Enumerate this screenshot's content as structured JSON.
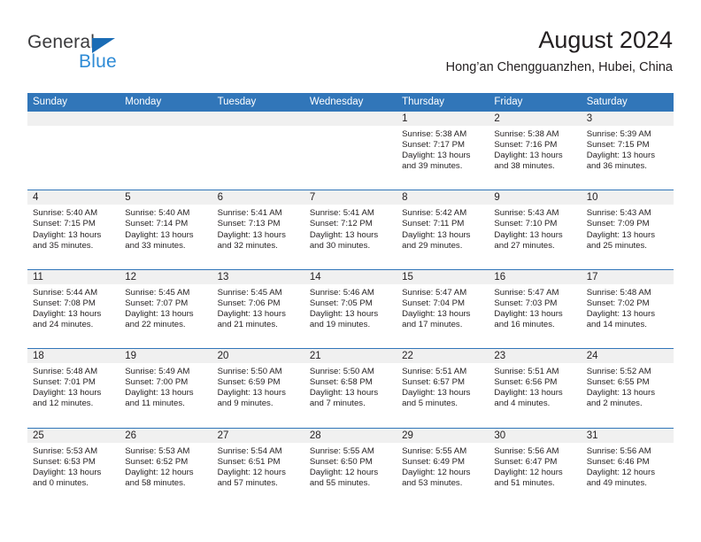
{
  "brand": {
    "name_part1": "General",
    "name_part2": "Blue",
    "triangle_color": "#1a6cb5",
    "blue_color": "#2e8bd6"
  },
  "header": {
    "title": "August 2024",
    "subtitle": "Hong’an Chengguanzhen, Hubei, China"
  },
  "colors": {
    "header_blue": "#3176b9",
    "day_band_gray": "#f0f0f0",
    "text": "#231f20"
  },
  "weekdays": [
    "Sunday",
    "Monday",
    "Tuesday",
    "Wednesday",
    "Thursday",
    "Friday",
    "Saturday"
  ],
  "weeks": [
    [
      {
        "day": "",
        "sunrise": "",
        "sunset": "",
        "daylight_line1": "",
        "daylight_line2": ""
      },
      {
        "day": "",
        "sunrise": "",
        "sunset": "",
        "daylight_line1": "",
        "daylight_line2": ""
      },
      {
        "day": "",
        "sunrise": "",
        "sunset": "",
        "daylight_line1": "",
        "daylight_line2": ""
      },
      {
        "day": "",
        "sunrise": "",
        "sunset": "",
        "daylight_line1": "",
        "daylight_line2": ""
      },
      {
        "day": "1",
        "sunrise": "Sunrise: 5:38 AM",
        "sunset": "Sunset: 7:17 PM",
        "daylight_line1": "Daylight: 13 hours",
        "daylight_line2": "and 39 minutes."
      },
      {
        "day": "2",
        "sunrise": "Sunrise: 5:38 AM",
        "sunset": "Sunset: 7:16 PM",
        "daylight_line1": "Daylight: 13 hours",
        "daylight_line2": "and 38 minutes."
      },
      {
        "day": "3",
        "sunrise": "Sunrise: 5:39 AM",
        "sunset": "Sunset: 7:15 PM",
        "daylight_line1": "Daylight: 13 hours",
        "daylight_line2": "and 36 minutes."
      }
    ],
    [
      {
        "day": "4",
        "sunrise": "Sunrise: 5:40 AM",
        "sunset": "Sunset: 7:15 PM",
        "daylight_line1": "Daylight: 13 hours",
        "daylight_line2": "and 35 minutes."
      },
      {
        "day": "5",
        "sunrise": "Sunrise: 5:40 AM",
        "sunset": "Sunset: 7:14 PM",
        "daylight_line1": "Daylight: 13 hours",
        "daylight_line2": "and 33 minutes."
      },
      {
        "day": "6",
        "sunrise": "Sunrise: 5:41 AM",
        "sunset": "Sunset: 7:13 PM",
        "daylight_line1": "Daylight: 13 hours",
        "daylight_line2": "and 32 minutes."
      },
      {
        "day": "7",
        "sunrise": "Sunrise: 5:41 AM",
        "sunset": "Sunset: 7:12 PM",
        "daylight_line1": "Daylight: 13 hours",
        "daylight_line2": "and 30 minutes."
      },
      {
        "day": "8",
        "sunrise": "Sunrise: 5:42 AM",
        "sunset": "Sunset: 7:11 PM",
        "daylight_line1": "Daylight: 13 hours",
        "daylight_line2": "and 29 minutes."
      },
      {
        "day": "9",
        "sunrise": "Sunrise: 5:43 AM",
        "sunset": "Sunset: 7:10 PM",
        "daylight_line1": "Daylight: 13 hours",
        "daylight_line2": "and 27 minutes."
      },
      {
        "day": "10",
        "sunrise": "Sunrise: 5:43 AM",
        "sunset": "Sunset: 7:09 PM",
        "daylight_line1": "Daylight: 13 hours",
        "daylight_line2": "and 25 minutes."
      }
    ],
    [
      {
        "day": "11",
        "sunrise": "Sunrise: 5:44 AM",
        "sunset": "Sunset: 7:08 PM",
        "daylight_line1": "Daylight: 13 hours",
        "daylight_line2": "and 24 minutes."
      },
      {
        "day": "12",
        "sunrise": "Sunrise: 5:45 AM",
        "sunset": "Sunset: 7:07 PM",
        "daylight_line1": "Daylight: 13 hours",
        "daylight_line2": "and 22 minutes."
      },
      {
        "day": "13",
        "sunrise": "Sunrise: 5:45 AM",
        "sunset": "Sunset: 7:06 PM",
        "daylight_line1": "Daylight: 13 hours",
        "daylight_line2": "and 21 minutes."
      },
      {
        "day": "14",
        "sunrise": "Sunrise: 5:46 AM",
        "sunset": "Sunset: 7:05 PM",
        "daylight_line1": "Daylight: 13 hours",
        "daylight_line2": "and 19 minutes."
      },
      {
        "day": "15",
        "sunrise": "Sunrise: 5:47 AM",
        "sunset": "Sunset: 7:04 PM",
        "daylight_line1": "Daylight: 13 hours",
        "daylight_line2": "and 17 minutes."
      },
      {
        "day": "16",
        "sunrise": "Sunrise: 5:47 AM",
        "sunset": "Sunset: 7:03 PM",
        "daylight_line1": "Daylight: 13 hours",
        "daylight_line2": "and 16 minutes."
      },
      {
        "day": "17",
        "sunrise": "Sunrise: 5:48 AM",
        "sunset": "Sunset: 7:02 PM",
        "daylight_line1": "Daylight: 13 hours",
        "daylight_line2": "and 14 minutes."
      }
    ],
    [
      {
        "day": "18",
        "sunrise": "Sunrise: 5:48 AM",
        "sunset": "Sunset: 7:01 PM",
        "daylight_line1": "Daylight: 13 hours",
        "daylight_line2": "and 12 minutes."
      },
      {
        "day": "19",
        "sunrise": "Sunrise: 5:49 AM",
        "sunset": "Sunset: 7:00 PM",
        "daylight_line1": "Daylight: 13 hours",
        "daylight_line2": "and 11 minutes."
      },
      {
        "day": "20",
        "sunrise": "Sunrise: 5:50 AM",
        "sunset": "Sunset: 6:59 PM",
        "daylight_line1": "Daylight: 13 hours",
        "daylight_line2": "and 9 minutes."
      },
      {
        "day": "21",
        "sunrise": "Sunrise: 5:50 AM",
        "sunset": "Sunset: 6:58 PM",
        "daylight_line1": "Daylight: 13 hours",
        "daylight_line2": "and 7 minutes."
      },
      {
        "day": "22",
        "sunrise": "Sunrise: 5:51 AM",
        "sunset": "Sunset: 6:57 PM",
        "daylight_line1": "Daylight: 13 hours",
        "daylight_line2": "and 5 minutes."
      },
      {
        "day": "23",
        "sunrise": "Sunrise: 5:51 AM",
        "sunset": "Sunset: 6:56 PM",
        "daylight_line1": "Daylight: 13 hours",
        "daylight_line2": "and 4 minutes."
      },
      {
        "day": "24",
        "sunrise": "Sunrise: 5:52 AM",
        "sunset": "Sunset: 6:55 PM",
        "daylight_line1": "Daylight: 13 hours",
        "daylight_line2": "and 2 minutes."
      }
    ],
    [
      {
        "day": "25",
        "sunrise": "Sunrise: 5:53 AM",
        "sunset": "Sunset: 6:53 PM",
        "daylight_line1": "Daylight: 13 hours",
        "daylight_line2": "and 0 minutes."
      },
      {
        "day": "26",
        "sunrise": "Sunrise: 5:53 AM",
        "sunset": "Sunset: 6:52 PM",
        "daylight_line1": "Daylight: 12 hours",
        "daylight_line2": "and 58 minutes."
      },
      {
        "day": "27",
        "sunrise": "Sunrise: 5:54 AM",
        "sunset": "Sunset: 6:51 PM",
        "daylight_line1": "Daylight: 12 hours",
        "daylight_line2": "and 57 minutes."
      },
      {
        "day": "28",
        "sunrise": "Sunrise: 5:55 AM",
        "sunset": "Sunset: 6:50 PM",
        "daylight_line1": "Daylight: 12 hours",
        "daylight_line2": "and 55 minutes."
      },
      {
        "day": "29",
        "sunrise": "Sunrise: 5:55 AM",
        "sunset": "Sunset: 6:49 PM",
        "daylight_line1": "Daylight: 12 hours",
        "daylight_line2": "and 53 minutes."
      },
      {
        "day": "30",
        "sunrise": "Sunrise: 5:56 AM",
        "sunset": "Sunset: 6:47 PM",
        "daylight_line1": "Daylight: 12 hours",
        "daylight_line2": "and 51 minutes."
      },
      {
        "day": "31",
        "sunrise": "Sunrise: 5:56 AM",
        "sunset": "Sunset: 6:46 PM",
        "daylight_line1": "Daylight: 12 hours",
        "daylight_line2": "and 49 minutes."
      }
    ]
  ]
}
